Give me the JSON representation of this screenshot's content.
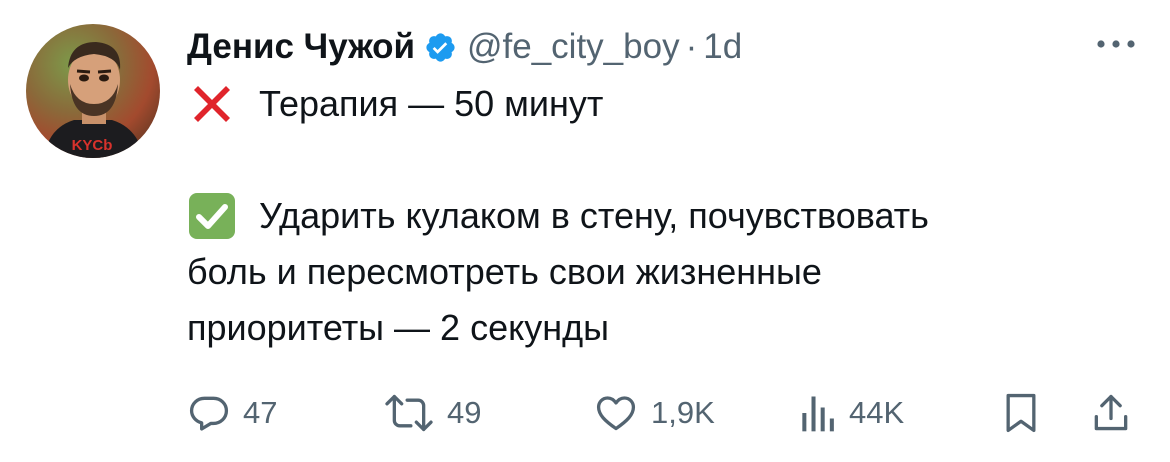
{
  "author": {
    "display_name": "Денис Чужой",
    "handle": "@fe_city_boy",
    "separator": "·",
    "time": "1d",
    "verified": true,
    "avatar_shirt_text": "KYCb"
  },
  "tweet": {
    "lines": [
      "Терапия — 50 минут",
      "",
      "Ударить кулаком в стену, почувствовать",
      "боль и пересмотреть свои жизненные",
      "приоритеты — 2 секунды"
    ],
    "emoji_cross": "❌",
    "emoji_check": "✅"
  },
  "actions": {
    "replies": "47",
    "reposts": "49",
    "likes": "1,9K",
    "views": "44K"
  },
  "colors": {
    "text": "#0f1419",
    "secondary": "#536471",
    "verified": "#1d9bf0",
    "cross": "#e0242b",
    "check": "#78b159"
  },
  "icons": {
    "verified": "verified-badge-icon",
    "more": "more-dots-icon",
    "reply": "reply-icon",
    "repost": "repost-icon",
    "like": "heart-icon",
    "views": "views-chart-icon",
    "bookmark": "bookmark-icon",
    "share": "share-icon"
  }
}
